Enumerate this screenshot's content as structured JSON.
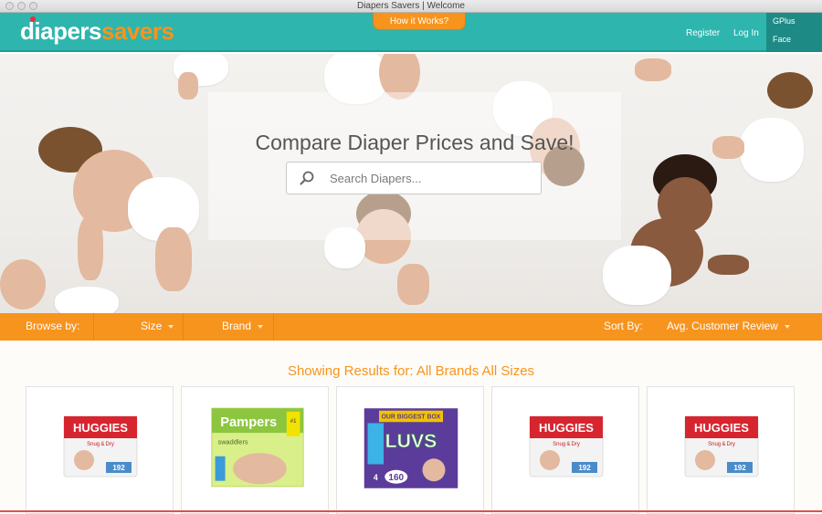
{
  "window": {
    "title": "Diapers Savers | Welcome"
  },
  "navbar": {
    "logo_part1": "diapers",
    "logo_part2": "savers",
    "how_label": "How it Works?",
    "register_label": "Register",
    "login_label": "Log In",
    "social": [
      "GPlus",
      "Face"
    ]
  },
  "hero": {
    "title": "Compare Diaper Prices and Save!",
    "search_placeholder": "Search Diapers..."
  },
  "filters": {
    "browse_label": "Browse by:",
    "size_label": "Size",
    "brand_label": "Brand",
    "sort_label": "Sort By:",
    "sort_value": "Avg. Customer Review"
  },
  "results": {
    "title": "Showing Results for: All Brands All Sizes",
    "products": [
      {
        "brand": "HUGGIES",
        "sub": "Snug & Dry",
        "count": "192",
        "color": "#d7252f"
      },
      {
        "brand": "Pampers",
        "sub": "swaddlers",
        "badge": "#1",
        "color": "#8cc63f"
      },
      {
        "brand": "LUVS",
        "sub": "OUR BIGGEST BOX",
        "count": "160",
        "size": "4",
        "color": "#5b3c9a"
      },
      {
        "brand": "HUGGIES",
        "sub": "Snug & Dry",
        "count": "192",
        "color": "#d7252f"
      },
      {
        "brand": "HUGGIES",
        "sub": "Snug & Dry",
        "count": "192",
        "color": "#d7252f"
      }
    ]
  },
  "colors": {
    "teal": "#2eb5ae",
    "orange": "#f7941d"
  }
}
